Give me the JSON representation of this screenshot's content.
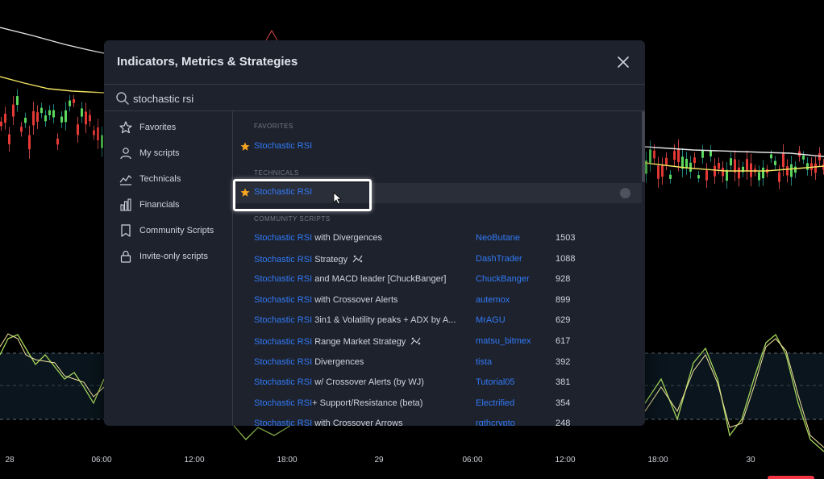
{
  "modal": {
    "title": "Indicators, Metrics & Strategies",
    "search_value": "stochastic rsi"
  },
  "sidebar": {
    "items": [
      {
        "label": "Favorites",
        "icon": "star-icon"
      },
      {
        "label": "My scripts",
        "icon": "user-icon"
      },
      {
        "label": "Technicals",
        "icon": "chart-icon"
      },
      {
        "label": "Financials",
        "icon": "bars-icon"
      },
      {
        "label": "Community Scripts",
        "icon": "bookmark-icon"
      },
      {
        "label": "Invite-only scripts",
        "icon": "lock-icon"
      }
    ]
  },
  "sections": {
    "favorites": "FAVORITES",
    "technicals": "TECHNICALS",
    "community": "COMMUNITY SCRIPTS"
  },
  "favorites_items": [
    {
      "highlight": "Stochastic RSI",
      "rest": ""
    }
  ],
  "technicals_items": [
    {
      "highlight": "Stochastic RSI",
      "rest": ""
    }
  ],
  "community_items": [
    {
      "highlight": "Stochastic RSI",
      "rest": " with Divergences",
      "author": "NeoButane",
      "count": "1503",
      "strategy": false
    },
    {
      "highlight": "Stochastic RSI",
      "rest": " Strategy",
      "author": "DashTrader",
      "count": "1088",
      "strategy": true
    },
    {
      "highlight": "Stochastic RSI",
      "rest": " and MACD leader [ChuckBanger]",
      "author": "ChuckBanger",
      "count": "928",
      "strategy": false
    },
    {
      "highlight": "Stochastic RSI",
      "rest": " with Crossover Alerts",
      "author": "autemox",
      "count": "899",
      "strategy": false
    },
    {
      "highlight": "Stochastic RSI",
      "rest": " 3in1 & Volatility peaks + ADX by A...",
      "author": "MrAGU",
      "count": "629",
      "strategy": false
    },
    {
      "highlight": "Stochastic RSI",
      "rest": " Range Market Strategy",
      "author": "matsu_bitmex",
      "count": "617",
      "strategy": true
    },
    {
      "highlight": "Stochastic RSI",
      "rest": " Divergences",
      "author": "tista",
      "count": "392",
      "strategy": false
    },
    {
      "highlight": "Stochastic RSI",
      "rest": " w/ Crossover Alerts (by WJ)",
      "author": "Tutorial05",
      "count": "381",
      "strategy": false
    },
    {
      "highlight": "Stochastic RSI",
      "rest": "+ Support/Resistance (beta)",
      "author": "Electrified",
      "count": "354",
      "strategy": false
    },
    {
      "highlight": "Stochastic RSI",
      "rest": " with Crossover Arrows",
      "author": "rgthcrypto",
      "count": "248",
      "strategy": false
    }
  ],
  "time_axis": [
    "28",
    "06:00",
    "12:00",
    "18:00",
    "29",
    "06:00",
    "12:00",
    "18:00",
    "30"
  ],
  "colors": {
    "accent_blue": "#3179f5",
    "favorite_star": "#f7a521",
    "panel_bg": "#1e222d",
    "candle_up": "#26a69a",
    "candle_down": "#ef5350"
  }
}
